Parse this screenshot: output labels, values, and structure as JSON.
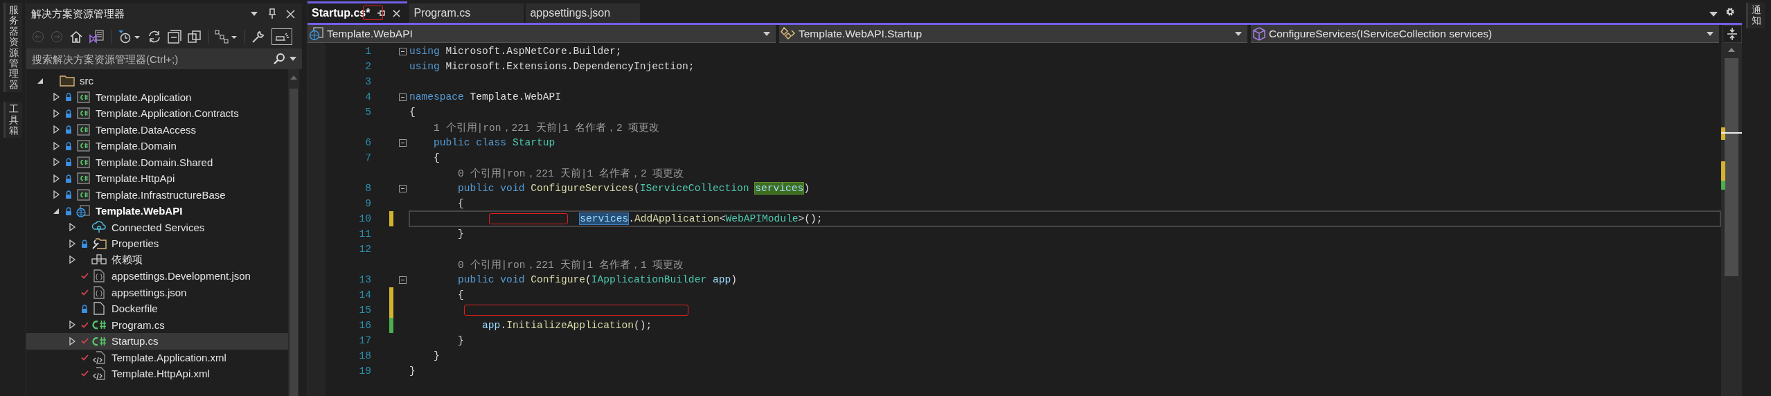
{
  "left_dock": {
    "tabs": [
      {
        "label": "服务器资源管理器"
      },
      {
        "label": "工具箱"
      }
    ]
  },
  "solution_explorer": {
    "title": "解决方案资源管理器",
    "search": {
      "placeholder": "搜索解决方案资源管理器(Ctrl+;)"
    },
    "tree": [
      {
        "label": "src",
        "kind": "folder",
        "expanded": true,
        "locked": false,
        "checked": false,
        "selected": false,
        "bold": false,
        "children": [
          {
            "label": "Template.Application",
            "kind": "project",
            "locked": true,
            "checked": false,
            "expanded": false,
            "selected": false,
            "bold": false
          },
          {
            "label": "Template.Application.Contracts",
            "kind": "project",
            "locked": true,
            "checked": false,
            "expanded": false,
            "selected": false,
            "bold": false
          },
          {
            "label": "Template.DataAccess",
            "kind": "project",
            "locked": true,
            "checked": false,
            "expanded": false,
            "selected": false,
            "bold": false
          },
          {
            "label": "Template.Domain",
            "kind": "project",
            "locked": true,
            "checked": false,
            "expanded": false,
            "selected": false,
            "bold": false
          },
          {
            "label": "Template.Domain.Shared",
            "kind": "project",
            "locked": true,
            "checked": false,
            "expanded": false,
            "selected": false,
            "bold": false
          },
          {
            "label": "Template.HttpApi",
            "kind": "project",
            "locked": true,
            "checked": false,
            "expanded": false,
            "selected": false,
            "bold": false
          },
          {
            "label": "Template.InfrastructureBase",
            "kind": "project",
            "locked": true,
            "checked": false,
            "expanded": false,
            "selected": false,
            "bold": false
          },
          {
            "label": "Template.WebAPI",
            "kind": "webproject",
            "locked": true,
            "checked": false,
            "expanded": true,
            "selected": false,
            "bold": true,
            "children": [
              {
                "label": "Connected Services",
                "kind": "service",
                "locked": false,
                "checked": false,
                "expanded": false,
                "selected": false,
                "bold": false
              },
              {
                "label": "Properties",
                "kind": "properties",
                "locked": true,
                "checked": false,
                "expanded": false,
                "selected": false,
                "bold": false
              },
              {
                "label": "依赖项",
                "kind": "dependencies",
                "locked": false,
                "checked": false,
                "expanded": false,
                "selected": false,
                "bold": false
              },
              {
                "label": "appsettings.Development.json",
                "kind": "json",
                "locked": false,
                "checked": true,
                "selected": false,
                "bold": false
              },
              {
                "label": "appsettings.json",
                "kind": "json",
                "locked": false,
                "checked": true,
                "selected": false,
                "bold": false
              },
              {
                "label": "Dockerfile",
                "kind": "file",
                "locked": true,
                "checked": false,
                "selected": false,
                "bold": false
              },
              {
                "label": "Program.cs",
                "kind": "code",
                "locked": false,
                "checked": true,
                "expanded": false,
                "selected": false,
                "bold": false
              },
              {
                "label": "Startup.cs",
                "kind": "code",
                "locked": false,
                "checked": true,
                "expanded": false,
                "selected": true,
                "bold": false
              },
              {
                "label": "Template.Application.xml",
                "kind": "xml",
                "locked": false,
                "checked": true,
                "selected": false,
                "bold": false
              },
              {
                "label": "Template.HttpApi.xml",
                "kind": "xml",
                "locked": false,
                "checked": true,
                "selected": false,
                "bold": false
              }
            ]
          }
        ]
      }
    ]
  },
  "editor": {
    "tabs": [
      {
        "label": "Startup.cs*",
        "selected": true,
        "marked": true
      },
      {
        "label": "Program.cs",
        "selected": false,
        "marked": false
      },
      {
        "label": "appsettings.json",
        "selected": false,
        "marked": false
      }
    ],
    "nav": [
      {
        "label": "Template.WebAPI",
        "kind": "project"
      },
      {
        "label": "Template.WebAPI.Startup",
        "kind": "class"
      },
      {
        "label": "ConfigureServices(IServiceCollection services)",
        "kind": "method"
      }
    ],
    "lines": [
      {
        "number": "1",
        "fold": true,
        "current": false,
        "marked": false,
        "changed": false,
        "tokens": [
          {
            "kind": "keyword",
            "text": "using"
          },
          {
            "kind": "plain",
            "text": " Microsoft.AspNetCore.Builder;"
          }
        ]
      },
      {
        "number": "2",
        "fold": false,
        "current": false,
        "marked": false,
        "changed": false,
        "tokens": [
          {
            "kind": "keyword",
            "text": "using"
          },
          {
            "kind": "plain",
            "text": " Microsoft.Extensions.DependencyInjection;"
          }
        ]
      },
      {
        "number": "3",
        "fold": false,
        "current": false,
        "marked": false,
        "changed": false
      },
      {
        "number": "4",
        "fold": true,
        "current": false,
        "marked": false,
        "changed": false,
        "tokens": [
          {
            "kind": "keyword",
            "text": "namespace"
          },
          {
            "kind": "plain",
            "text": " Template.WebAPI"
          }
        ]
      },
      {
        "number": "5",
        "fold": false,
        "current": false,
        "marked": false,
        "changed": false,
        "tokens": [
          {
            "kind": "plain",
            "text": "{"
          }
        ]
      },
      {
        "fold": false,
        "current": false,
        "marked": false,
        "changed": false,
        "tokens": [
          {
            "kind": "lens",
            "text": "    1 个引用|ron，221 天前|1 名作者，2 项更改"
          }
        ]
      },
      {
        "number": "6",
        "fold": true,
        "current": false,
        "marked": false,
        "changed": false,
        "tokens": [
          {
            "kind": "keyword",
            "text": "    public class "
          },
          {
            "kind": "type",
            "text": "Startup"
          }
        ]
      },
      {
        "number": "7",
        "fold": false,
        "current": false,
        "marked": false,
        "changed": false,
        "tokens": [
          {
            "kind": "plain",
            "text": "    {"
          }
        ]
      },
      {
        "fold": false,
        "current": false,
        "marked": false,
        "changed": false,
        "tokens": [
          {
            "kind": "lens",
            "text": "        0 个引用|ron，221 天前|1 名作者，2 项更改"
          }
        ]
      },
      {
        "number": "8",
        "fold": true,
        "current": false,
        "marked": false,
        "changed": false,
        "tokens": [
          {
            "kind": "keyword",
            "text": "        public void "
          },
          {
            "kind": "method",
            "text": "ConfigureServices"
          },
          {
            "kind": "plain",
            "text": "("
          },
          {
            "kind": "type",
            "text": "IServiceCollection "
          },
          {
            "kind": "param",
            "text": "services",
            "highlighted": true,
            "selected": false
          },
          {
            "kind": "plain",
            "text": ")"
          }
        ]
      },
      {
        "number": "9",
        "fold": false,
        "current": false,
        "marked": false,
        "changed": false,
        "tokens": [
          {
            "kind": "plain",
            "text": "        {"
          }
        ]
      },
      {
        "number": "10",
        "fold": false,
        "current": true,
        "marked": true,
        "changed": true,
        "saved": false,
        "tokens": [
          {
            "kind": "param",
            "text": "                            services",
            "highlighted": true,
            "selected": true
          },
          {
            "kind": "plain",
            "text": "."
          },
          {
            "kind": "method",
            "text": "AddApplication"
          },
          {
            "kind": "plain",
            "text": "<"
          },
          {
            "kind": "type",
            "text": "WebAPIModule"
          },
          {
            "kind": "plain",
            "text": ">();"
          }
        ]
      },
      {
        "number": "11",
        "fold": false,
        "current": false,
        "marked": false,
        "changed": false,
        "tokens": [
          {
            "kind": "plain",
            "text": "        }"
          }
        ]
      },
      {
        "number": "12",
        "fold": false,
        "current": false,
        "marked": false,
        "changed": false
      },
      {
        "fold": false,
        "current": false,
        "marked": false,
        "changed": false,
        "tokens": [
          {
            "kind": "lens",
            "text": "        0 个引用|ron，221 天前|1 名作者，1 项更改"
          }
        ]
      },
      {
        "number": "13",
        "fold": true,
        "current": false,
        "marked": false,
        "changed": false,
        "tokens": [
          {
            "kind": "keyword",
            "text": "        public void "
          },
          {
            "kind": "method",
            "text": "Configure"
          },
          {
            "kind": "plain",
            "text": "("
          },
          {
            "kind": "type",
            "text": "IApplicationBuilder "
          },
          {
            "kind": "param",
            "text": "app"
          },
          {
            "kind": "plain",
            "text": ")"
          }
        ]
      },
      {
        "number": "14",
        "fold": false,
        "current": false,
        "marked": false,
        "changed": true,
        "saved": false,
        "tokens": [
          {
            "kind": "plain",
            "text": "        {"
          }
        ]
      },
      {
        "number": "15",
        "fold": false,
        "current": false,
        "marked": true,
        "changed": true,
        "saved": false
      },
      {
        "number": "16",
        "fold": false,
        "current": false,
        "marked": false,
        "changed": true,
        "saved": true,
        "tokens": [
          {
            "kind": "param",
            "text": "            app"
          },
          {
            "kind": "plain",
            "text": "."
          },
          {
            "kind": "method",
            "text": "InitializeApplication"
          },
          {
            "kind": "plain",
            "text": "();"
          }
        ]
      },
      {
        "number": "17",
        "fold": false,
        "current": false,
        "marked": false,
        "changed": false,
        "tokens": [
          {
            "kind": "plain",
            "text": "        }"
          }
        ]
      },
      {
        "number": "18",
        "fold": false,
        "current": false,
        "marked": false,
        "changed": false,
        "tokens": [
          {
            "kind": "plain",
            "text": "    }"
          }
        ]
      },
      {
        "number": "19",
        "fold": false,
        "current": false,
        "marked": false,
        "changed": false,
        "tokens": [
          {
            "kind": "plain",
            "text": "}"
          }
        ]
      }
    ]
  },
  "right_dock": {
    "tabs": [
      {
        "label": "通知"
      }
    ]
  }
}
